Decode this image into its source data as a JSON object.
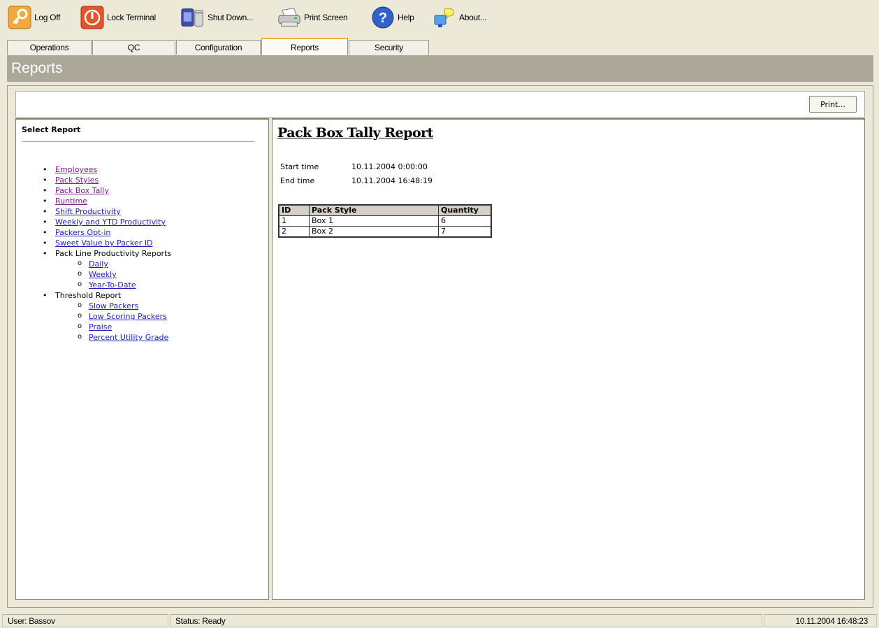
{
  "toolbar": {
    "items": [
      {
        "label": "Log Off",
        "icon": "key-icon"
      },
      {
        "label": "Lock Terminal",
        "icon": "power-icon"
      },
      {
        "label": "Shut Down...",
        "icon": "shutdown-icon"
      },
      {
        "label": "Print Screen",
        "icon": "printer-icon"
      },
      {
        "label": "Help",
        "icon": "help-icon"
      },
      {
        "label": "About...",
        "icon": "about-icon"
      }
    ]
  },
  "tabs": [
    {
      "label": "Operations",
      "active": false
    },
    {
      "label": "QC",
      "active": false
    },
    {
      "label": "Configuration",
      "active": false
    },
    {
      "label": "Reports",
      "active": true
    },
    {
      "label": "Security",
      "active": false
    }
  ],
  "page_title": "Reports",
  "print_button": "Print...",
  "sidebar": {
    "title": "Select Report",
    "items": [
      {
        "label": "Employees",
        "link": true,
        "visited": true
      },
      {
        "label": "Pack Styles",
        "link": true,
        "visited": true
      },
      {
        "label": "Pack Box Tally",
        "link": true,
        "visited": true
      },
      {
        "label": "Runtime",
        "link": true,
        "visited": true
      },
      {
        "label": "Shift Productivity",
        "link": true
      },
      {
        "label": "Weekly and YTD Productivity",
        "link": true
      },
      {
        "label": "Packers Opt-in",
        "link": true
      },
      {
        "label": "Sweet Value by Packer ID",
        "link": true
      },
      {
        "label": "Pack Line Productivity Reports",
        "link": false,
        "children": [
          {
            "label": "Daily"
          },
          {
            "label": "Weekly"
          },
          {
            "label": "Year-To-Date"
          }
        ]
      },
      {
        "label": "Threshold Report",
        "link": false,
        "children": [
          {
            "label": "Slow Packers"
          },
          {
            "label": "Low Scoring Packers"
          },
          {
            "label": "Praise"
          },
          {
            "label": "Percent Utility Grade"
          }
        ]
      }
    ]
  },
  "report": {
    "title": "Pack Box Tally Report",
    "start_label": "Start time",
    "start_value": "10.11.2004 0:00:00",
    "end_label": "End time",
    "end_value": "10.11.2004 16:48:19",
    "table": {
      "headers": [
        "ID",
        "Pack Style",
        "Quantity"
      ],
      "rows": [
        [
          "1",
          "Box 1",
          "6"
        ],
        [
          "2",
          "Box 2",
          "7"
        ]
      ]
    }
  },
  "statusbar": {
    "user": "User: Bassov",
    "status": "Status: Ready",
    "datetime": "10.11.2004  16:48:23"
  }
}
